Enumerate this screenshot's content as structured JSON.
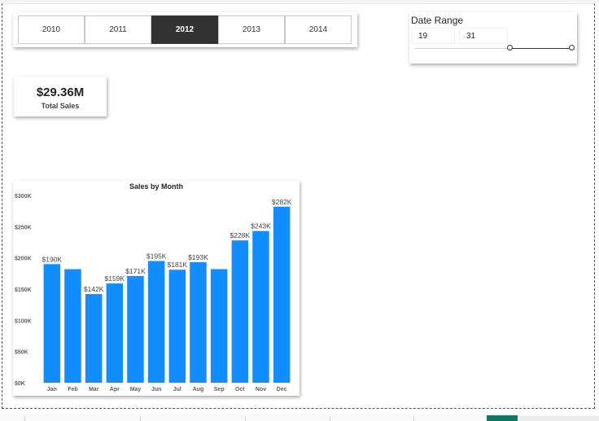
{
  "year_slicer": {
    "years": [
      "2010",
      "2011",
      "2012",
      "2013",
      "2014"
    ],
    "selected": "2012"
  },
  "date_range": {
    "title": "Date Range",
    "from": "19",
    "to": "31"
  },
  "kpi": {
    "value": "$29.36M",
    "label": "Total Sales"
  },
  "colors": {
    "bar": "#118dff",
    "selected_button": "#333333",
    "active_tab": "#117865"
  },
  "chart_data": {
    "type": "bar",
    "title": "Sales by Month",
    "categories": [
      "Jan",
      "Feb",
      "Mar",
      "Apr",
      "May",
      "Jun",
      "Jul",
      "Aug",
      "Sep",
      "Oct",
      "Nov",
      "Dec"
    ],
    "values": [
      190000,
      182000,
      142000,
      159000,
      171000,
      195000,
      181000,
      193000,
      182000,
      228000,
      243000,
      282000
    ],
    "data_labels": [
      "$190K",
      "",
      "$142K",
      "$159K",
      "$171K",
      "$195K",
      "$181K",
      "$193K",
      "",
      "$228K",
      "$243K",
      "$282K"
    ],
    "y_ticks": [
      0,
      50000,
      100000,
      150000,
      200000,
      250000,
      300000
    ],
    "y_tick_labels": [
      "$0K",
      "$50K",
      "$100K",
      "$150K",
      "$200K",
      "$250K",
      "$300K"
    ],
    "ylim": [
      0,
      300000
    ],
    "xlabel": "",
    "ylabel": "",
    "grid": false,
    "legend": "none"
  }
}
